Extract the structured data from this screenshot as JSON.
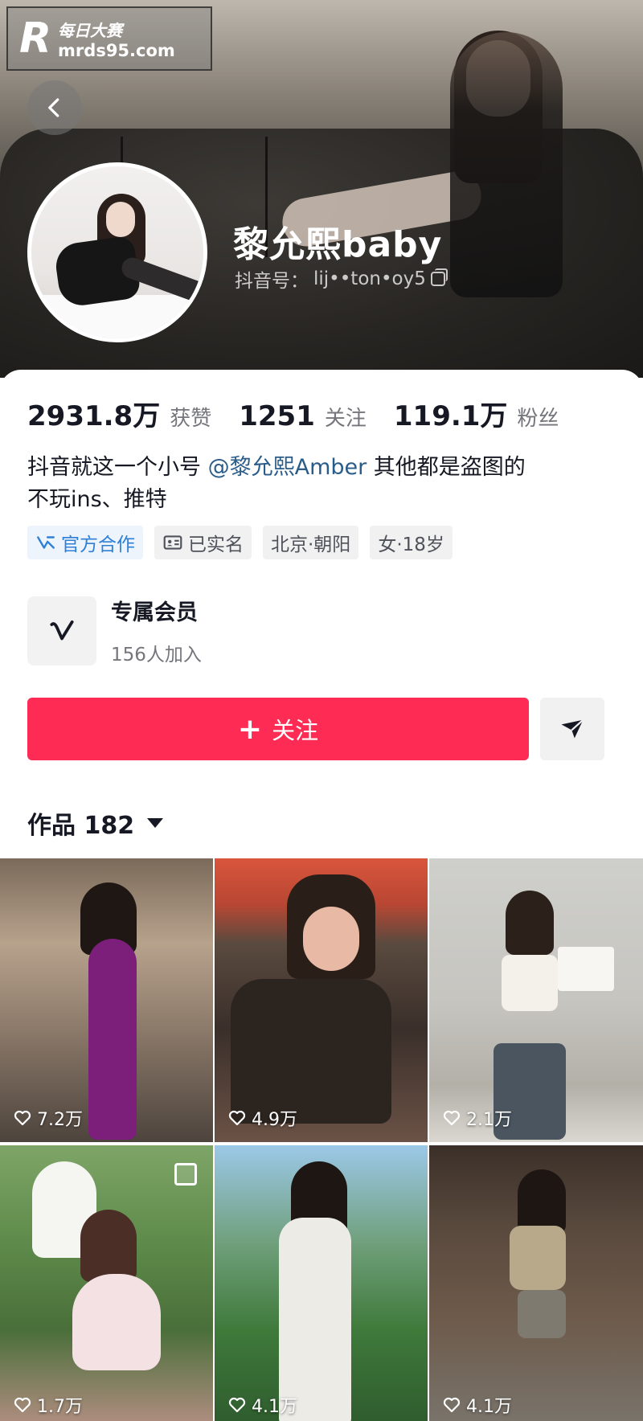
{
  "watermark": {
    "logo_letter": "R",
    "site_name": "每日大赛",
    "url": "mrds95.com"
  },
  "profile": {
    "nickname": "黎允熙baby",
    "douyin_id_label": "抖音号：",
    "douyin_id": "lij••ton•oy5",
    "stats": [
      {
        "value": "2931.8万",
        "label": "获赞"
      },
      {
        "value": "1251",
        "label": "关注"
      },
      {
        "value": "119.1万",
        "label": "粉丝"
      }
    ],
    "bio_prefix": "抖音就这一个小号 ",
    "bio_mention": "@黎允熙Amber",
    "bio_suffix": " 其他都是盗图的",
    "bio_line2": "不玩ins、推特",
    "tags": [
      "官方合作",
      "已实名",
      "北京·朝阳",
      "女·18岁"
    ]
  },
  "membership": {
    "title": "专属会员",
    "subtitle": "156人加入"
  },
  "actions": {
    "follow_plus": "+",
    "follow_label": "关注"
  },
  "works": {
    "tab_label": "作品 182",
    "items": [
      {
        "likes": "7.2万",
        "multi": false
      },
      {
        "likes": "4.9万",
        "multi": false
      },
      {
        "likes": "2.1万",
        "multi": false
      },
      {
        "likes": "1.7万",
        "multi": true
      },
      {
        "likes": "4.1万",
        "multi": false
      },
      {
        "likes": "4.1万",
        "multi": false
      }
    ]
  },
  "colors": {
    "accent": "#fe2c55",
    "mention": "#2a5c8a",
    "official": "#2e7fd6"
  },
  "icons": [
    "back-chevron-icon",
    "copy-icon",
    "official-badge-icon",
    "id-card-icon",
    "vip-v-icon",
    "share-paper-plane-icon",
    "caret-down-icon",
    "heart-icon",
    "multi-image-icon"
  ]
}
